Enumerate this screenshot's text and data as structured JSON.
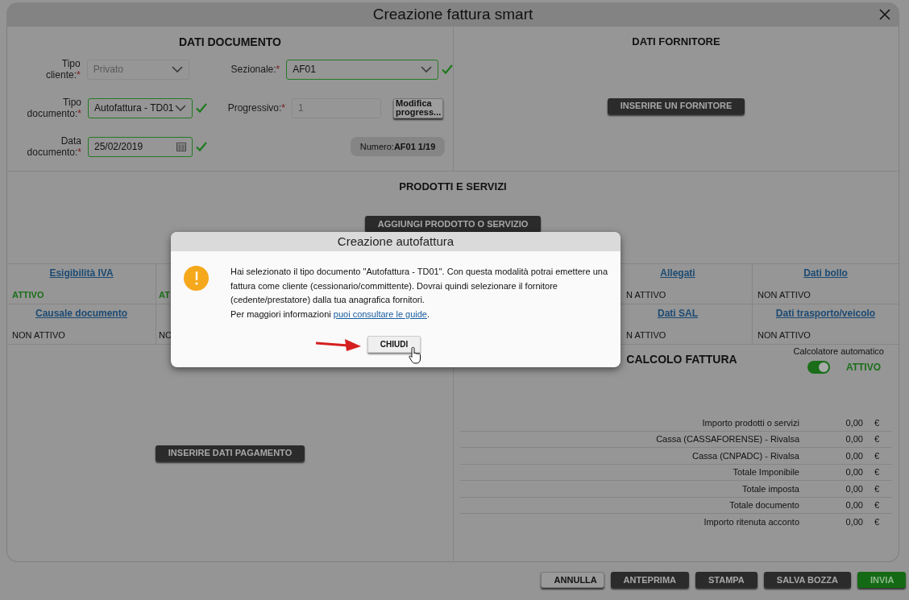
{
  "window": {
    "title": "Creazione fattura smart"
  },
  "dati_documento": {
    "title": "DATI DOCUMENTO",
    "tipo_cliente": {
      "label": "Tipo cliente:",
      "required": "*",
      "value": "Privato",
      "disabled": true,
      "valid": false
    },
    "sezionale": {
      "label": "Sezionale:",
      "required": "*",
      "value": "AF01",
      "disabled": false,
      "valid": true
    },
    "tipo_documento": {
      "label": "Tipo documento:",
      "required": "*",
      "value": "Autofattura - TD01",
      "disabled": false,
      "valid": true
    },
    "progressivo": {
      "label": "Progressivo:",
      "required": "*",
      "value": "1",
      "disabled": true
    },
    "modifica_button": "Modifica progress...",
    "data_documento": {
      "label": "Data documento:",
      "required": "*",
      "value": "25/02/2019",
      "valid": true
    },
    "numero": {
      "label": "Numero:",
      "value": "AF01 1/19"
    }
  },
  "dati_fornitore": {
    "title": "DATI FORNITORE",
    "button": "INSERIRE UN FORNITORE"
  },
  "prodotti": {
    "title": "PRODOTTI E SERVIZI",
    "button": "AGGIUNGI PRODOTTO O SERVIZIO"
  },
  "options": [
    [
      {
        "title": "Esigibilità IVA",
        "status": "ATTIVO",
        "active": true
      },
      {
        "status": "AT",
        "active": true
      },
      {
        "title": "Allegati",
        "status": "N ATTIVO",
        "active": false
      },
      {
        "title": "Dati bollo",
        "status": "NON ATTIVO",
        "active": false
      }
    ],
    [
      {
        "title": "Causale documento",
        "status": "NON ATTIVO",
        "active": false
      },
      {
        "status": "NO",
        "active": false
      },
      {
        "title": "Dati SAL",
        "status": "N ATTIVO",
        "active": false
      },
      {
        "title": "Dati trasporto/veicolo",
        "status": "NON ATTIVO",
        "active": false
      }
    ]
  ],
  "pagamento": {
    "button": "INSERIRE DATI PAGAMENTO"
  },
  "calcolo": {
    "title": "CALCOLO FATTURA",
    "auto_label": "Calcolatore automatico",
    "auto_on": true,
    "auto_status": "ATTIVO",
    "rows": [
      {
        "label": "Importo prodotti o servizi",
        "value": "0,00",
        "currency": "€"
      },
      {
        "label": "Cassa (CASSAFORENSE) - Rivalsa",
        "value": "0,00",
        "currency": "€"
      },
      {
        "label": "Cassa (CNPADC) - Rivalsa",
        "value": "0,00",
        "currency": "€"
      },
      {
        "label": "Totale Imponibile",
        "value": "0,00",
        "currency": "€"
      },
      {
        "label": "Totale imposta",
        "value": "0,00",
        "currency": "€"
      },
      {
        "label": "Totale documento",
        "value": "0,00",
        "currency": "€"
      },
      {
        "label": "Importo ritenuta acconto",
        "value": "0,00",
        "currency": "€"
      }
    ]
  },
  "footer_buttons": [
    {
      "label": "ANNULLA",
      "kind": "light"
    },
    {
      "label": "ANTEPRIMA",
      "kind": "dark"
    },
    {
      "label": "STAMPA",
      "kind": "dark"
    },
    {
      "label": "SALVA BOZZA",
      "kind": "dark"
    },
    {
      "label": "INVIA",
      "kind": "primary"
    }
  ],
  "dialog": {
    "title": "Creazione autofattura",
    "lines": [
      "Hai selezionato il tipo documento \"Autofattura - TD01\". Con questa modalità potrai emettere una",
      "fattura come cliente (cessionario/committente). Dovrai quindi selezionare il fornitore",
      "(cedente/prestatore) dalla tua anagrafica fornitori."
    ],
    "info_prefix": "Per maggiori informazioni",
    "info_link": "puoi consultare le guide",
    "info_suffix": ".",
    "button": "CHIUDI"
  }
}
